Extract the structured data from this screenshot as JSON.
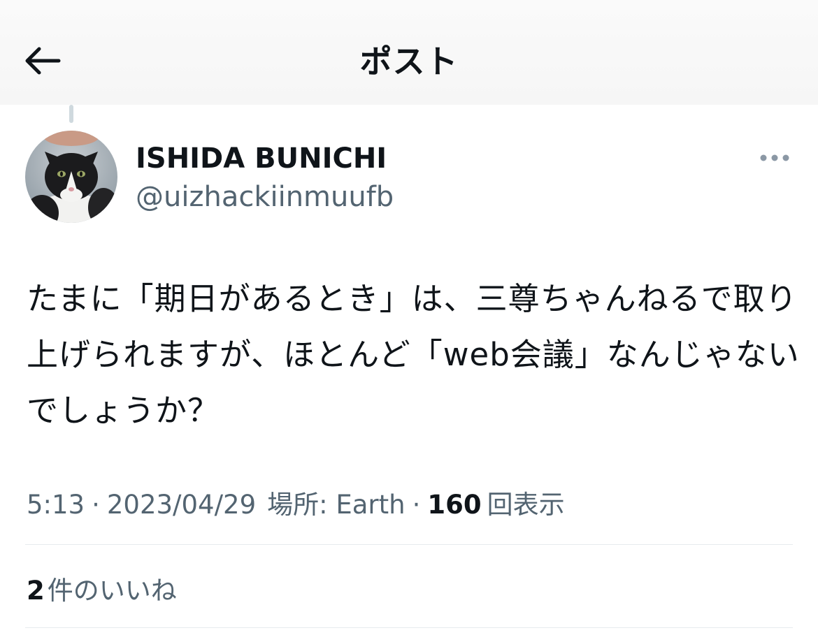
{
  "header": {
    "title": "ポスト",
    "back_icon": "arrow-left-icon"
  },
  "author": {
    "name": "ISHIDA BUNICHI",
    "handle": "@uizhackiinmuufb",
    "avatar": "cat-avatar",
    "more_icon": "more-horizontal-icon"
  },
  "post": {
    "lines": [
      "たまに「期日があるとき」は、三尊ちゃんねるで取り",
      "上げられますが、ほとんど「web会議」なんじゃない",
      "でしょうか？"
    ]
  },
  "meta": {
    "time": "5:13",
    "separator": "·",
    "date": "2023/04/29",
    "location": "場所: Earth",
    "views_count": "160",
    "views_label": "回表示"
  },
  "engagement": {
    "likes_count": "2",
    "likes_label": "件のいいね"
  }
}
